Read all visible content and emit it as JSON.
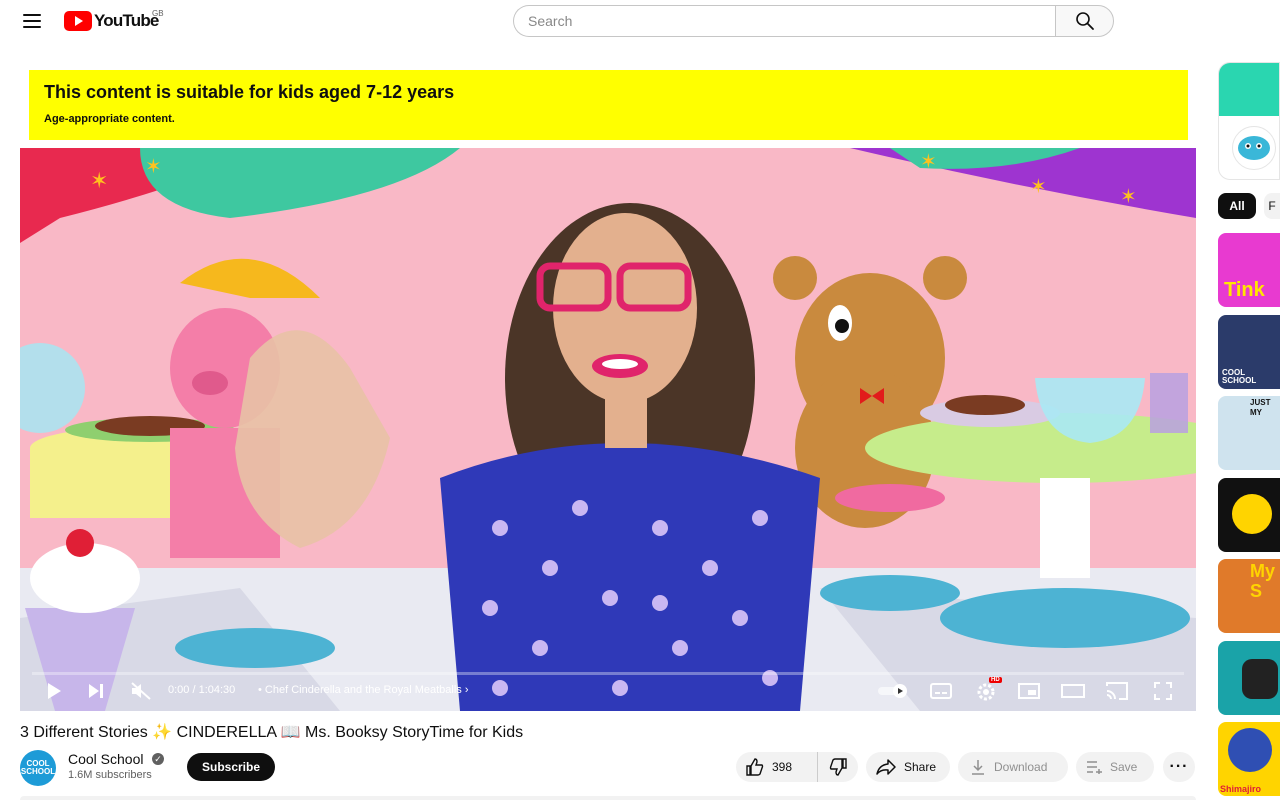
{
  "masthead": {
    "logo_text": "YouTube",
    "region": "GB",
    "search_placeholder": "Search"
  },
  "age_banner": {
    "title": "This content is suitable for kids aged 7-12 years",
    "subtitle": "Age-appropriate content."
  },
  "player": {
    "progress_fraction": 0,
    "time": "0:00 / 1:04:30",
    "chapter": "Chef Cinderella and the Royal Meatballs",
    "quality_badge": "HD",
    "muted": true
  },
  "video": {
    "title": "3 Different Stories ✨ CINDERELLA 📖 Ms. Booksy StoryTime for Kids",
    "channel_name": "Cool School",
    "channel_avatar_text": "COOL SCHOOL",
    "subscribers": "1.6M subscribers",
    "subscribe_label": "Subscribe",
    "like_count": "398",
    "share_label": "Share",
    "download_label": "Download",
    "save_label": "Save"
  },
  "rail": {
    "chips": [
      "All",
      "F"
    ],
    "thumbnails": [
      {
        "label": "Tink",
        "bg": "#e83ad0"
      },
      {
        "label": "COOL SCHOOL",
        "bg": "#2b3b6a"
      },
      {
        "label": "JUST MY",
        "bg": "#cfe3ee"
      },
      {
        "label": "",
        "bg": "#111111"
      },
      {
        "label": "My S",
        "bg": "#e07a2a"
      },
      {
        "label": "",
        "bg": "#1aa3a8"
      },
      {
        "label": "Shimajiro",
        "bg": "#ffd400"
      }
    ]
  },
  "colors": {
    "banner": "#ffff00",
    "brand_red": "#ff0000",
    "subscribe_bg": "#0f0f0f"
  }
}
